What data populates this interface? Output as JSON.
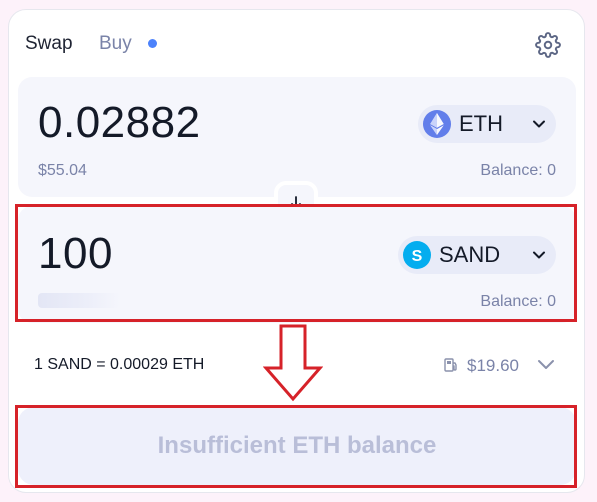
{
  "tabs": {
    "swap": "Swap",
    "buy": "Buy"
  },
  "colors": {
    "accent": "#4c82fb",
    "highlight": "#d62229",
    "eth": "#627eea",
    "sand": "#04adef"
  },
  "sell": {
    "amount": "0.02882",
    "fiat": "$55.04",
    "token": "ETH",
    "token_icon": "eth-icon",
    "balance": "Balance: 0"
  },
  "buy": {
    "amount": "100",
    "token": "SAND",
    "token_icon": "sand-icon",
    "balance": "Balance: 0"
  },
  "rate": {
    "text": "1 SAND = 0.00029 ETH",
    "gas": "$19.60"
  },
  "cta": {
    "label": "Insufficient ETH balance"
  }
}
